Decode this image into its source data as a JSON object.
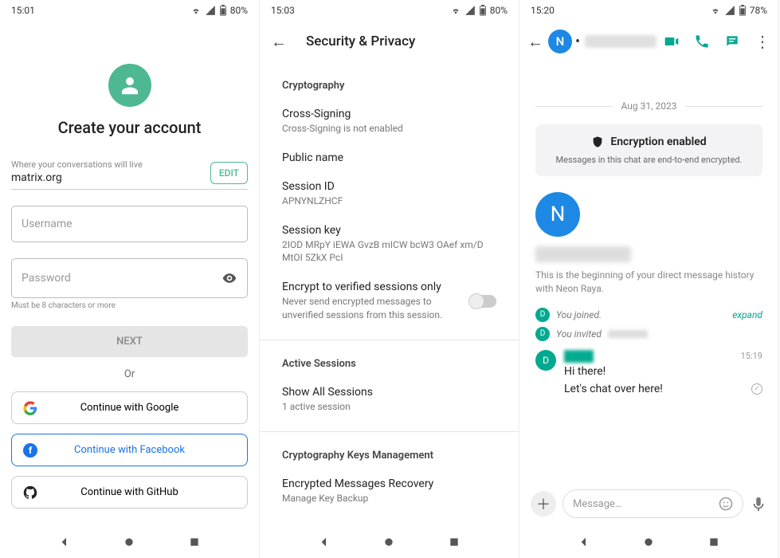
{
  "screen1": {
    "status": {
      "time": "15:01",
      "battery": "80%"
    },
    "title": "Create your account",
    "server": {
      "label": "Where your conversations will live",
      "value": "matrix.org",
      "edit": "EDIT"
    },
    "username_placeholder": "Username",
    "password_placeholder": "Password",
    "password_hint": "Must be 8 characters or more",
    "next": "NEXT",
    "or": "Or",
    "oauth": {
      "google": "Continue with Google",
      "facebook": "Continue with Facebook",
      "github": "Continue with GitHub"
    }
  },
  "screen2": {
    "status": {
      "time": "15:03",
      "battery": "80%"
    },
    "title": "Security & Privacy",
    "sections": {
      "cryptography": "Cryptography",
      "active_sessions": "Active Sessions",
      "keys_mgmt": "Cryptography Keys Management"
    },
    "items": {
      "cross_signing": {
        "title": "Cross-Signing",
        "sub": "Cross-Signing is not enabled"
      },
      "public_name": {
        "title": "Public name"
      },
      "session_id": {
        "title": "Session ID",
        "sub": "APNYNLZHCF"
      },
      "session_key": {
        "title": "Session key",
        "sub": "2IOD MRpY iEWA GvzB mICW bcW3 OAef xm/D MtOI 5ZkX PcI"
      },
      "encrypt_verified": {
        "title": "Encrypt to verified sessions only",
        "sub": "Never send encrypted messages to unverified sessions from this session."
      },
      "show_all": {
        "title": "Show All Sessions",
        "sub": "1 active session"
      },
      "recovery": {
        "title": "Encrypted Messages Recovery",
        "sub": "Manage Key Backup"
      }
    }
  },
  "screen3": {
    "status": {
      "time": "15:20",
      "battery": "78%"
    },
    "avatar_letter": "N",
    "date": "Aug 31, 2023",
    "encryption": {
      "title": "Encryption enabled",
      "sub": "Messages in this chat are end-to-end encrypted."
    },
    "dm_blurb": "This is the beginning of your direct message history with Neon Raya.",
    "events": {
      "joined": "You joined.",
      "invited": "You invited",
      "expand": "expand"
    },
    "message": {
      "time": "15:19",
      "text1": "Hi there!",
      "text2": "Let's chat over here!"
    },
    "composer_placeholder": "Message…"
  }
}
